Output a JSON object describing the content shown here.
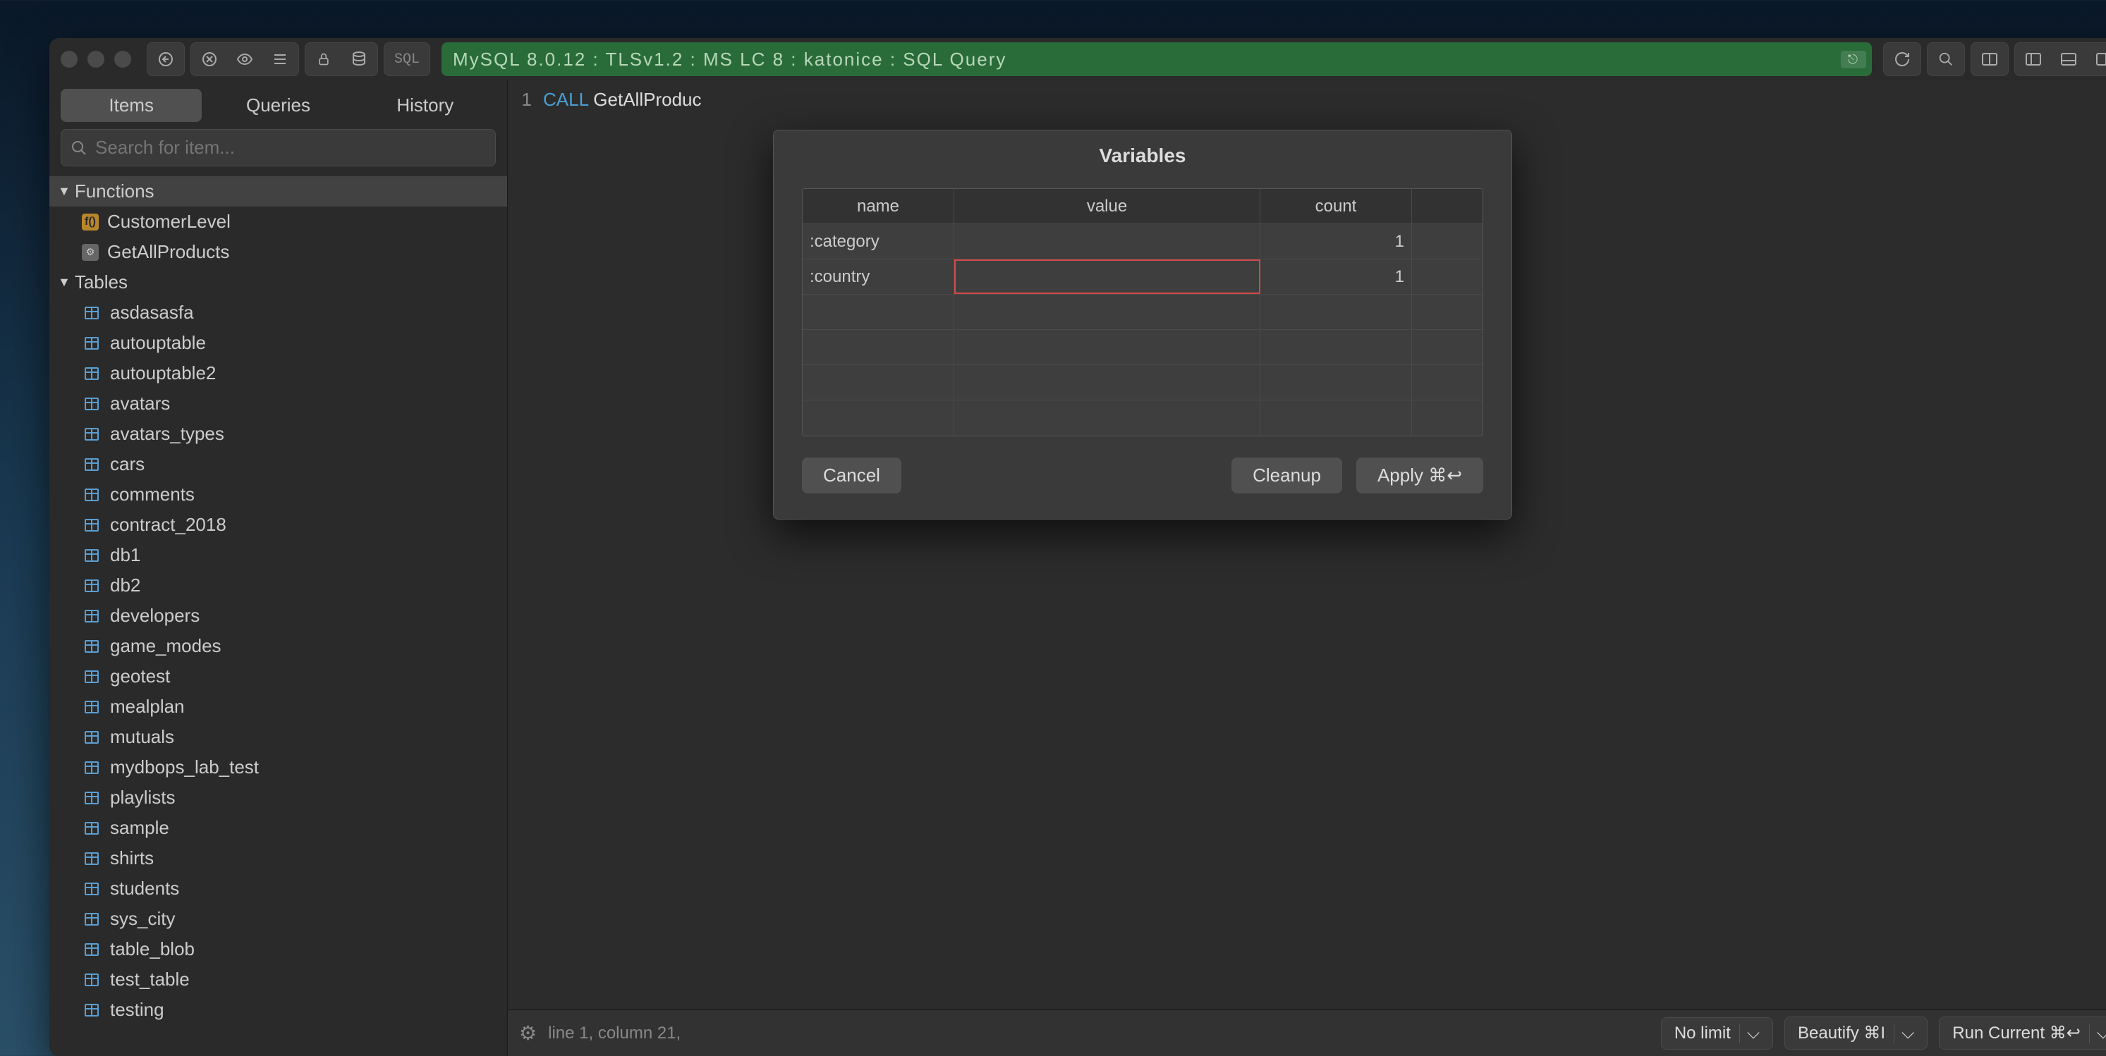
{
  "connection": "MySQL 8.0.12 : TLSv1.2 : MS LC 8 : katonice : SQL Query",
  "sql_badge": "SQL",
  "tabs": {
    "items": "Items",
    "queries": "Queries",
    "history": "History"
  },
  "search": {
    "placeholder": "Search for item..."
  },
  "tree": {
    "functions_label": "Functions",
    "functions": [
      {
        "name": "CustomerLevel",
        "kind": "fn"
      },
      {
        "name": "GetAllProducts",
        "kind": "proc"
      }
    ],
    "tables_label": "Tables",
    "tables": [
      "asdasasfa",
      "autouptable",
      "autouptable2",
      "avatars",
      "avatars_types",
      "cars",
      "comments",
      "contract_2018",
      "db1",
      "db2",
      "developers",
      "game_modes",
      "geotest",
      "mealplan",
      "mutuals",
      "mydbops_lab_test",
      "playlists",
      "sample",
      "shirts",
      "students",
      "sys_city",
      "table_blob",
      "test_table",
      "testing"
    ]
  },
  "editor": {
    "line_no": "1",
    "keyword": "CALL",
    "rest": " GetAllProduc",
    "status": "line 1, column 21,"
  },
  "status_buttons": {
    "limit": "No limit",
    "beautify": "Beautify ⌘I",
    "run": "Run Current ⌘↩"
  },
  "modal": {
    "title": "Variables",
    "headers": {
      "name": "name",
      "value": "value",
      "count": "count"
    },
    "rows": [
      {
        "name": ":category",
        "value": "",
        "count": "1",
        "invalid": false
      },
      {
        "name": ":country",
        "value": "",
        "count": "1",
        "invalid": true
      }
    ],
    "cancel": "Cancel",
    "cleanup": "Cleanup",
    "apply": "Apply ⌘↩"
  }
}
